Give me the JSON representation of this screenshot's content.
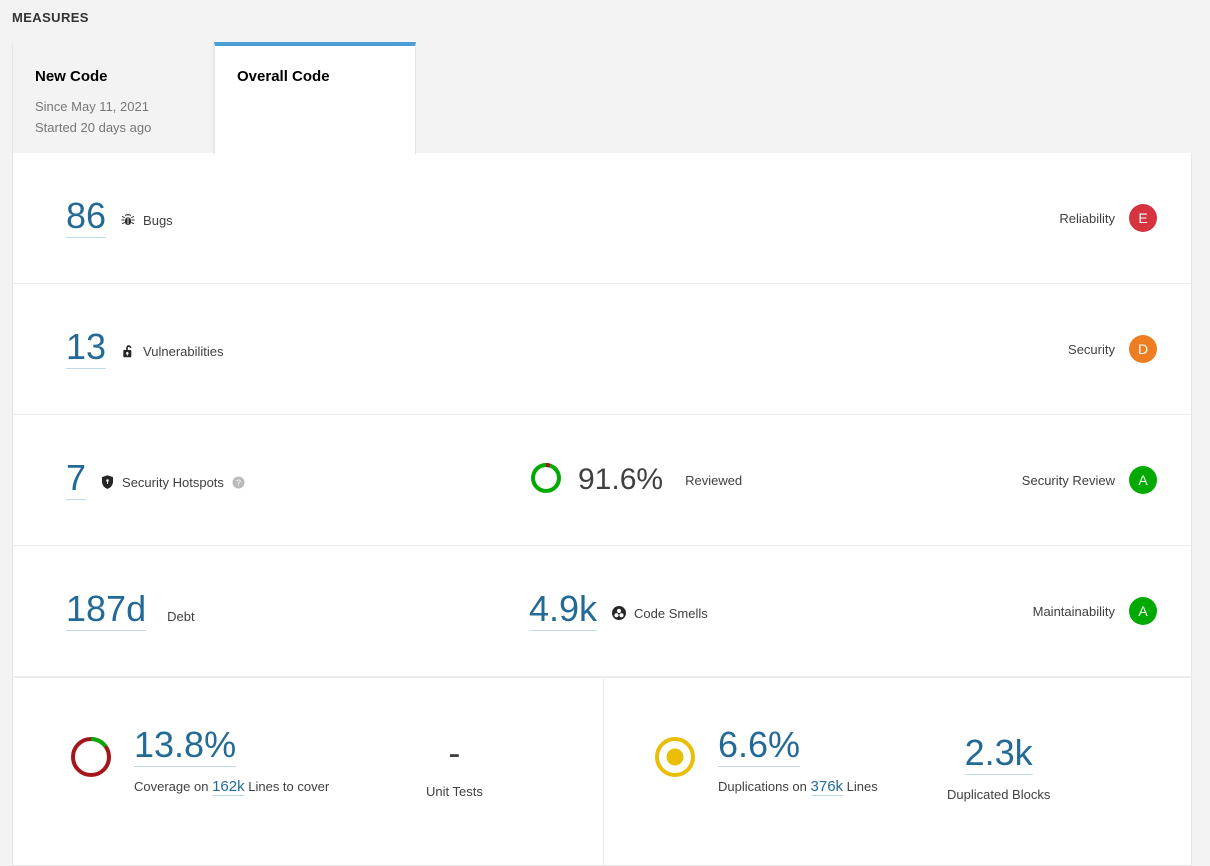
{
  "header": {
    "title": "MEASURES"
  },
  "tabs": [
    {
      "name": "New Code",
      "sub1": "Since May 11, 2021",
      "sub2": "Started 20 days ago",
      "active": false
    },
    {
      "name": "Overall Code",
      "sub1": "",
      "sub2": "",
      "active": true
    }
  ],
  "rows": [
    {
      "value": "86",
      "icon": "bug-icon",
      "label": "Bugs",
      "rating_name": "Reliability",
      "rating": "E",
      "rating_color": "#d4333f"
    },
    {
      "value": "13",
      "icon": "vulnerability-icon",
      "label": "Vulnerabilities",
      "rating_name": "Security",
      "rating": "D",
      "rating_color": "#ed7d20"
    },
    {
      "value": "7",
      "icon": "security-hotspot-icon",
      "label": "Security Hotspots",
      "help": "?",
      "secondary_pct": "91.6%",
      "secondary_label": "Reviewed",
      "secondary_gauge_pct": 91.6,
      "rating_name": "Security Review",
      "rating": "A",
      "rating_color": "#00aa00"
    },
    {
      "value": "187d",
      "label": "Debt",
      "secondary_value": "4.9k",
      "secondary_icon": "code-smell-icon",
      "secondary_label": "Code Smells",
      "rating_name": "Maintainability",
      "rating": "A",
      "rating_color": "#00aa00"
    }
  ],
  "coverage": {
    "percent": "13.8%",
    "gauge_pct": 13.8,
    "prefix": "Coverage on",
    "lines_value": "162k",
    "suffix": "Lines to cover",
    "unit_tests_value": "-",
    "unit_tests_label": "Unit Tests"
  },
  "duplications": {
    "percent": "6.6%",
    "prefix": "Duplications on",
    "lines_value": "376k",
    "suffix": "Lines",
    "blocks_value": "2.3k",
    "blocks_label": "Duplicated Blocks"
  },
  "colors": {
    "link": "#236a97",
    "green": "#00aa00",
    "red": "#a4161a",
    "yellow": "#eabe06",
    "tab_accent": "#4b9fd5",
    "page_bg": "#f3f3f3"
  }
}
